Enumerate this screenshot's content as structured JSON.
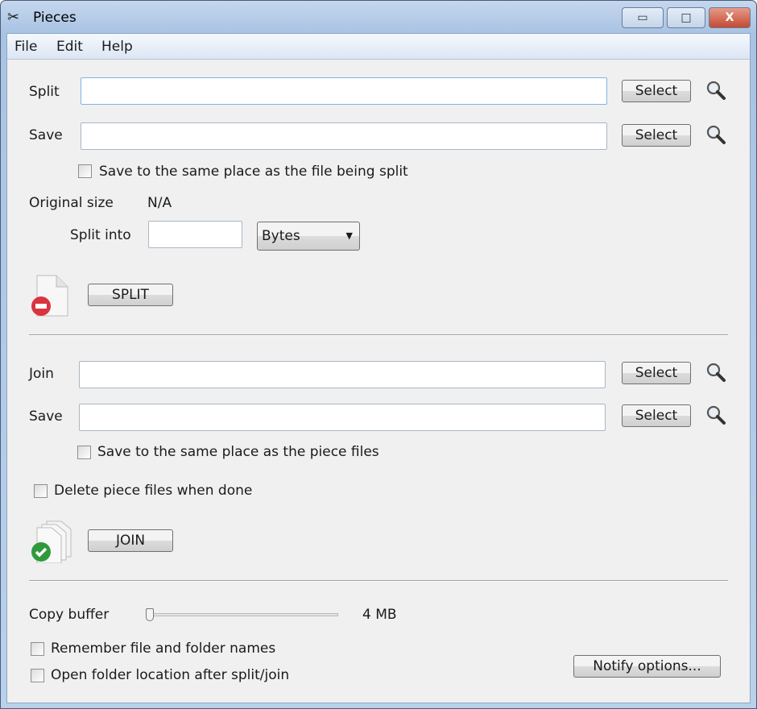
{
  "window": {
    "title": "Pieces",
    "minimize": "▭",
    "maximize": "□",
    "close": "X"
  },
  "menu": [
    "File",
    "Edit",
    "Help"
  ],
  "split": {
    "label": "Split",
    "value": "",
    "select": "Select",
    "save_label": "Save",
    "save_value": "",
    "save_select": "Select",
    "same_place": "Save to the same place as the file being split",
    "same_place_checked": false,
    "original_size_label": "Original size",
    "original_size": "N/A",
    "split_into_label": "Split into",
    "split_into_value": "",
    "unit": "Bytes",
    "button": "SPLIT"
  },
  "join": {
    "label": "Join",
    "value": "",
    "select": "Select",
    "save_label": "Save",
    "save_value": "",
    "save_select": "Select",
    "same_place": "Save to the same place as the piece files",
    "same_place_checked": false,
    "delete": "Delete piece files when done",
    "delete_checked": false,
    "button": "JOIN"
  },
  "options": {
    "copy_buffer_label": "Copy buffer",
    "copy_buffer_value": "4 MB",
    "slider_fraction": 0,
    "remember": "Remember file and folder names",
    "remember_checked": false,
    "open_folder": "Open folder location after split/join",
    "open_folder_checked": false,
    "notify": "Notify options..."
  }
}
